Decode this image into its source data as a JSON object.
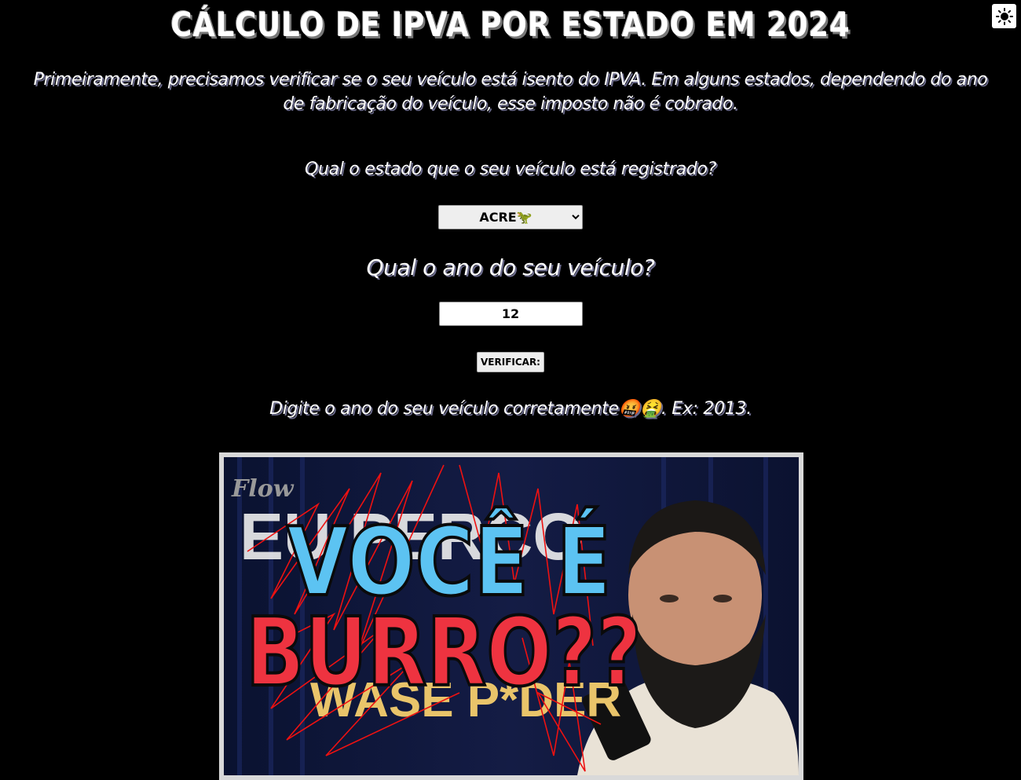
{
  "title": "CÁLCULO DE IPVA POR ESTADO EM 2024",
  "intro": "Primeiramente, precisamos verificar se o seu veículo está isento do IPVA. Em alguns estados, dependendo do ano de fabricação do veículo, esse imposto não é cobrado.",
  "theme_toggle_icon": "sun-icon",
  "state_question": "Qual o estado que o seu veículo está registrado?",
  "state_select": {
    "selected": "ACRE🦖"
  },
  "year_question": "Qual o ano do seu veículo?",
  "year_input": {
    "value": "12"
  },
  "verify_button": "VERIFICAR:",
  "result_message": "Digite o ano do seu veículo corretamente🤬🤮. Ex: 2013.",
  "meme": {
    "line1": "VOCÊ É",
    "line2": "BURRO??",
    "logo_text": "Flow",
    "bg_text_top": "EU PERCO",
    "bg_text_bottom": "WASE P*DER"
  }
}
